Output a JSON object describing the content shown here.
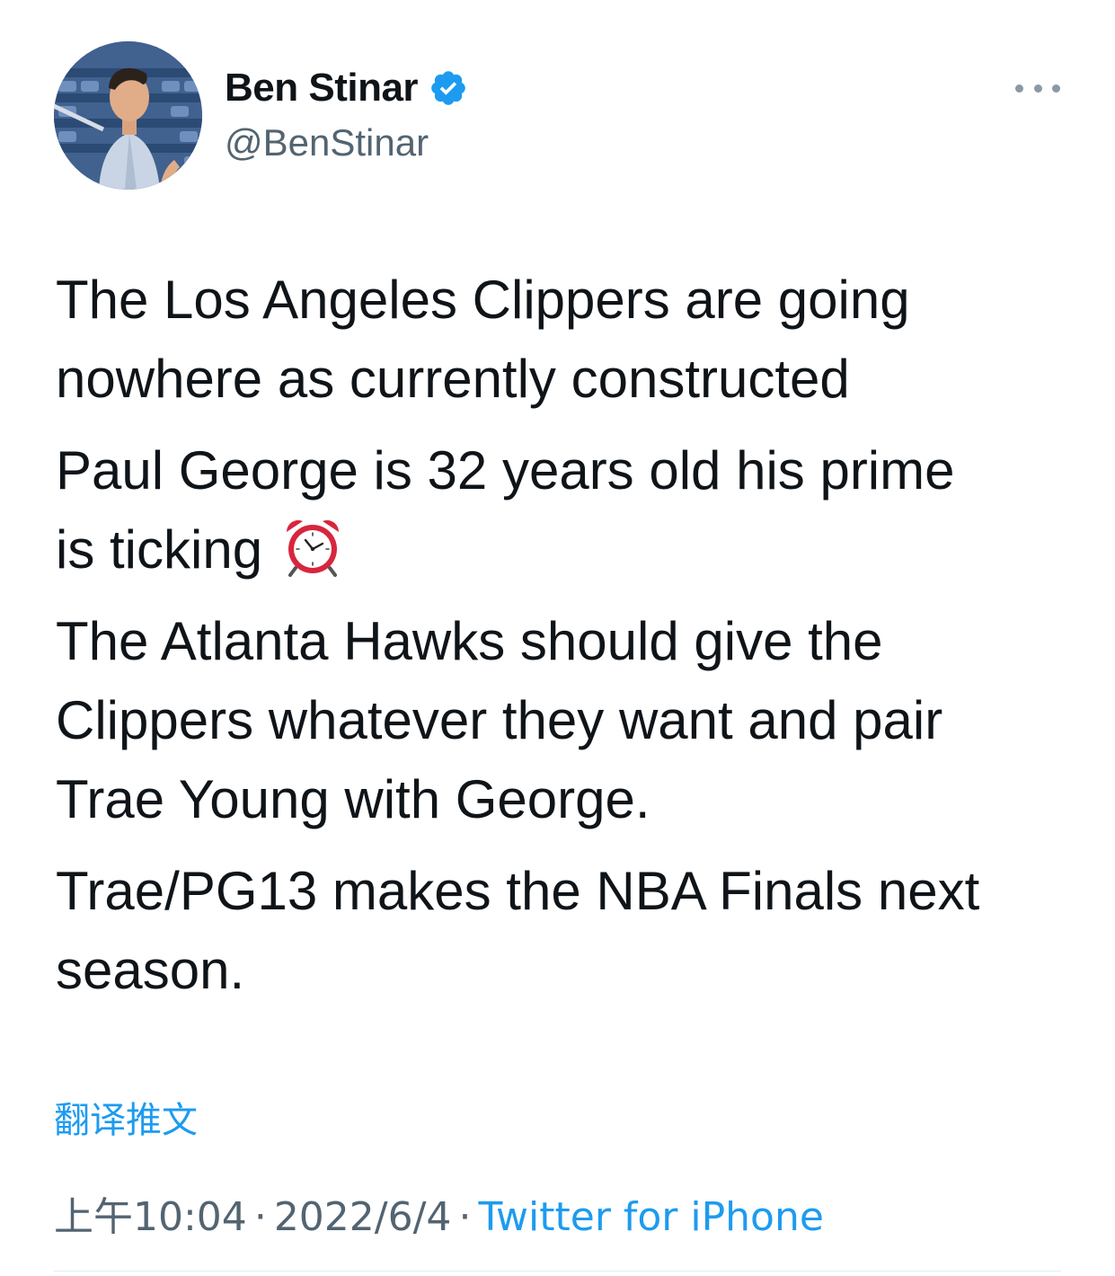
{
  "author": {
    "display_name": "Ben Stinar",
    "handle": "@BenStinar",
    "verified": true
  },
  "tweet": {
    "paragraphs": [
      "The Los Angeles Clippers are going nowhere as currently constructed",
      "Paul George is 32 years old his prime is ticking",
      "The Atlanta Hawks should give the Clippers whatever they want and pair Trae Young with George.",
      "Trae/PG13 makes the NBA Finals next season."
    ],
    "lines": [
      "The Los Angeles Clippers are going",
      "nowhere as currently constructed",
      "Paul George is 32 years old his prime",
      "is ticking",
      "The Atlanta Hawks should give the",
      "Clippers whatever they want and pair",
      "Trae Young with George.",
      "Trae/PG13 makes the NBA Finals next",
      "season."
    ],
    "emoji": "alarm-clock-icon"
  },
  "translate_label": "翻译推文",
  "meta": {
    "time": "上午10:04",
    "separator": "·",
    "date": "2022/6/4",
    "source": "Twitter for iPhone"
  },
  "colors": {
    "text": "#0f1419",
    "secondary": "#536471",
    "accent": "#1d9bf0",
    "verified": "#1d9bf0"
  },
  "icons": [
    "verified-badge-icon",
    "more-options-icon",
    "alarm-clock-icon"
  ]
}
